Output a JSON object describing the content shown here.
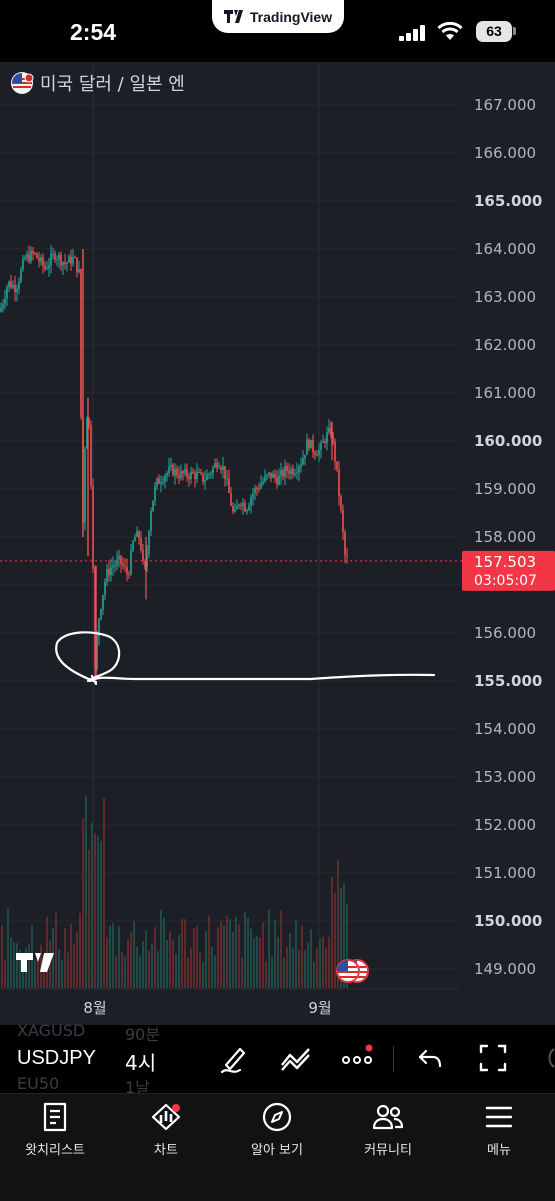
{
  "status_bar": {
    "time": "2:54",
    "app_pill": "TradingView",
    "battery": "63"
  },
  "chart": {
    "symbol_title": "미국 달러 / 일본 엔",
    "price_axis_labels": [
      "167.000",
      "166.000",
      "165.000",
      "164.000",
      "163.000",
      "162.000",
      "161.000",
      "160.000",
      "159.000",
      "158.000",
      "157.000",
      "156.000",
      "155.000",
      "154.000",
      "153.000",
      "152.000",
      "151.000",
      "150.000",
      "149.000"
    ],
    "bold_price_labels": [
      "165.000",
      "160.000",
      "155.000",
      "150.000"
    ],
    "current_price": "157.503",
    "countdown": "03:05:07",
    "time_axis_labels": [
      "8월",
      "9월"
    ],
    "colors": {
      "up": "#26a69a",
      "down": "#ef5350",
      "background": "#1d1f26",
      "price_tag": "#f23645"
    }
  },
  "chart_data": {
    "type": "candlestick",
    "title": "미국 달러 / 일본 엔",
    "symbol": "USDJPY",
    "interval": "4시",
    "x_labels": [
      "8월",
      "9월"
    ],
    "ylim": [
      148.6,
      167.5
    ],
    "last_price": 157.503,
    "approx_path": [
      {
        "phase": "late July",
        "low": 162.6,
        "high": 164.0
      },
      {
        "phase": "early Aug drop",
        "low": 155.1,
        "high": 160.9
      },
      {
        "phase": "mid Aug",
        "low": 156.7,
        "high": 159.5
      },
      {
        "phase": "late Aug - early Sep",
        "low": 158.0,
        "high": 160.4
      },
      {
        "phase": "last",
        "low": 157.5,
        "high": 160.0
      }
    ]
  },
  "toolbar": {
    "ticker": "USDJPY",
    "interval": "4시",
    "ghost_rows": [
      "XAGUSD",
      "90분",
      "EU50",
      "1날"
    ],
    "tools": [
      "draw-icon",
      "patterns-icon",
      "more-icon",
      "undo-icon",
      "fullscreen-icon"
    ]
  },
  "tabs": [
    {
      "label": "왓치리스트",
      "icon": "watchlist-icon"
    },
    {
      "label": "차트",
      "icon": "chart-icon"
    },
    {
      "label": "알아 보기",
      "icon": "compass-icon"
    },
    {
      "label": "커뮤니티",
      "icon": "community-icon"
    },
    {
      "label": "메뉴",
      "icon": "menu-icon"
    }
  ]
}
